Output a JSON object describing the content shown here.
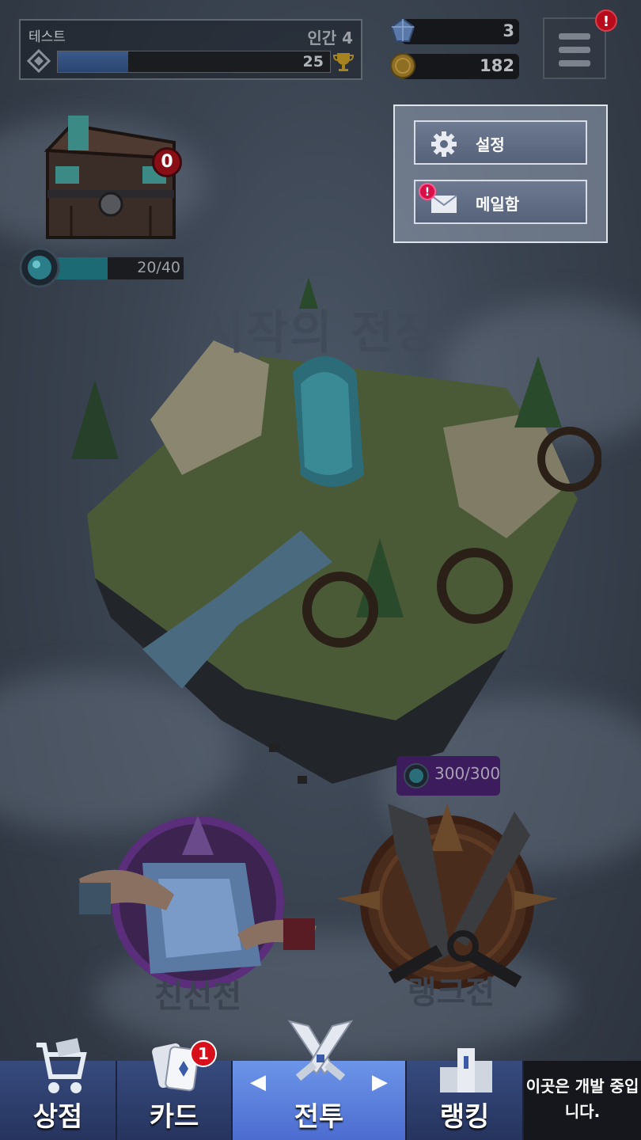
{
  "player": {
    "name": "테스트",
    "rank": "인간 4",
    "trophies": "25",
    "exp_fraction": 0.26
  },
  "currency": {
    "gems": "3",
    "gold": "182"
  },
  "menu": {
    "alert": "!",
    "items": [
      {
        "label": "설정",
        "icon": "gear-icon"
      },
      {
        "label": "메일함",
        "icon": "mail-icon",
        "alert": "!"
      }
    ]
  },
  "chest": {
    "count": "0",
    "energy": "20/40",
    "energy_fraction": 0.5
  },
  "stage": {
    "title": "시작의 전장"
  },
  "modes": {
    "friendly": {
      "label": "친선전"
    },
    "ranked": {
      "label": "랭크전",
      "stamina": "300/300"
    }
  },
  "nav": {
    "shop": "상점",
    "cards": "카드",
    "cards_badge": "1",
    "battle": "전투",
    "ranking": "랭킹",
    "dev_notice": "이곳은 개발 중입니다.",
    "arrow_left": "◀",
    "arrow_right": "▶"
  },
  "colors": {
    "nav_active": "#5a82e0",
    "alert": "#b80c1c",
    "energy": "#1c6a74",
    "stamina_tag": "#3c1c5c"
  }
}
